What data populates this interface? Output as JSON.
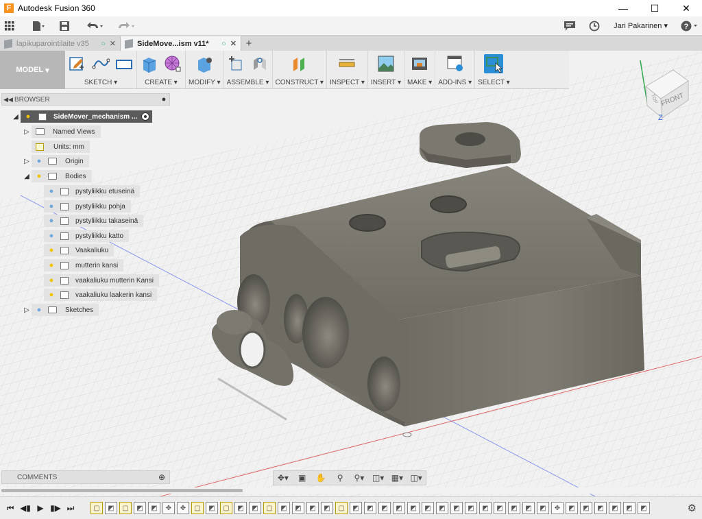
{
  "window": {
    "title": "Autodesk Fusion 360",
    "app_icon_letter": "F"
  },
  "quick_access": {
    "user_name": "Jari Pakarinen"
  },
  "tabs": [
    {
      "label": "lapikuparointilaite v35"
    },
    {
      "label": "SideMove...ism v11*"
    }
  ],
  "toolbar": {
    "workspace": "MODEL",
    "groups": [
      {
        "label": "SKETCH"
      },
      {
        "label": "CREATE"
      },
      {
        "label": "MODIFY"
      },
      {
        "label": "ASSEMBLE"
      },
      {
        "label": "CONSTRUCT"
      },
      {
        "label": "INSPECT"
      },
      {
        "label": "INSERT"
      },
      {
        "label": "MAKE"
      },
      {
        "label": "ADD-INS"
      },
      {
        "label": "SELECT"
      }
    ]
  },
  "browser": {
    "title": "BROWSER",
    "root": "SideMover_mechanism ...",
    "named_views": "Named Views",
    "units": "Units: mm",
    "origin": "Origin",
    "bodies_label": "Bodies",
    "bodies": [
      "pystyliikku etuseinä",
      "pystyliikku pohja",
      "pystyliikku takaseinä",
      "pystyliikku katto",
      "Vaakaliuku",
      "mutterin kansi",
      "vaakaliuku mutterin Kansi",
      "vaakaliuku laakerin kansi"
    ],
    "sketches": "Sketches"
  },
  "comments": {
    "title": "COMMENTS"
  },
  "viewcube": {
    "face_front": "FRONT",
    "face_top": "TOP",
    "axis_z": "Z"
  },
  "colors": {
    "accent": "#2b8fd8",
    "select_active": "#3a8f5a",
    "model_body": "#747168",
    "bulb_on": "#f2c200",
    "bulb_off": "#6fa8dc"
  }
}
